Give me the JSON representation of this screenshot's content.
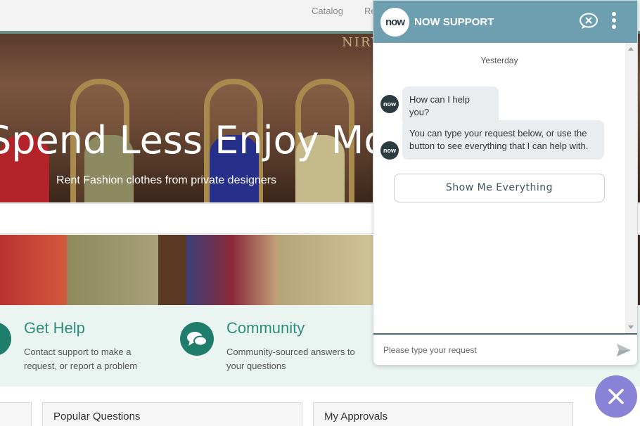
{
  "topnav": {
    "links": [
      "Catalog",
      "Re"
    ]
  },
  "hero": {
    "brand": "NIRV",
    "title": "Spend Less Enjoy More",
    "subtitle": "Rent Fashion clothes from private designers"
  },
  "help_band": {
    "items": [
      {
        "title": "Get Help",
        "description": "Contact support to make a request, or report a problem",
        "icon": "help-icon"
      },
      {
        "title": "Community",
        "description": "Community-sourced answers to your questions",
        "icon": "chat-bubbles-icon"
      }
    ]
  },
  "cards": {
    "popular_questions": "Popular Questions",
    "my_approvals": "My Approvals"
  },
  "chat": {
    "logo_text": "now",
    "title": "NOW SUPPORT",
    "day_label": "Yesterday",
    "avatar_text": "now",
    "messages": [
      "How can I help you?",
      "You can type your request below, or use the button to see everything that I can help with."
    ],
    "show_button": "Show Me Everything",
    "input_placeholder": "Please type your request",
    "colors": {
      "header": "#6d9fb0",
      "bubble": "#e9edf0",
      "fab": "#8a82d6"
    }
  }
}
